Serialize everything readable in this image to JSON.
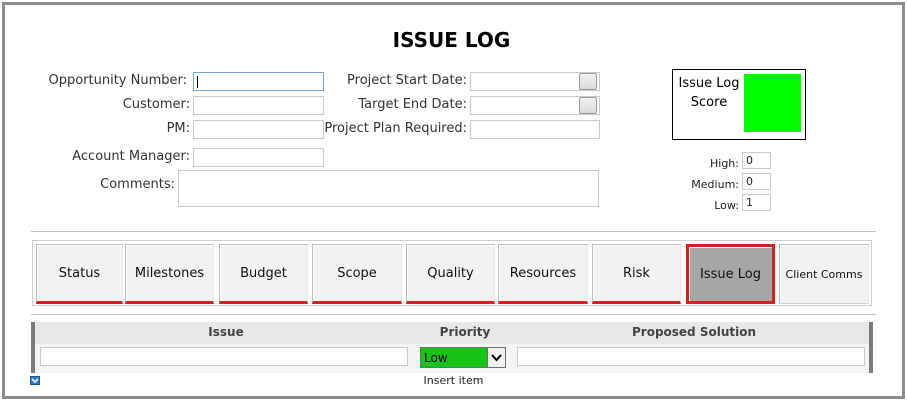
{
  "form": {
    "title": "ISSUE LOG",
    "fields": {
      "opportunity_number": {
        "label": "Opportunity Number:",
        "value": ""
      },
      "customer": {
        "label": "Customer:",
        "value": ""
      },
      "pm": {
        "label": "PM:",
        "value": ""
      },
      "account_manager": {
        "label": "Account Manager:",
        "value": ""
      },
      "comments": {
        "label": "Comments:",
        "value": ""
      },
      "project_start_date": {
        "label": "Project Start Date:",
        "value": ""
      },
      "target_end_date": {
        "label": "Target End Date:",
        "value": ""
      },
      "project_plan_required": {
        "label": "Project Plan Required:",
        "value": ""
      }
    }
  },
  "score": {
    "label": "Issue Log Score",
    "color": "#00ff00",
    "high_label": "High:",
    "high_value": "0",
    "medium_label": "Medium:",
    "medium_value": "0",
    "low_label": "Low:",
    "low_value": "1"
  },
  "tabs": [
    {
      "label": "Status"
    },
    {
      "label": "Milestones"
    },
    {
      "label": "Budget"
    },
    {
      "label": "Scope"
    },
    {
      "label": "Quality"
    },
    {
      "label": "Resources"
    },
    {
      "label": "Risk"
    },
    {
      "label": "Issue Log",
      "active": true
    },
    {
      "label": "Client Comms"
    }
  ],
  "grid": {
    "columns": {
      "issue": "Issue",
      "priority": "Priority",
      "solution": "Proposed Solution"
    },
    "row": {
      "issue": "",
      "priority": "Low",
      "solution": ""
    },
    "priority_color": "#16c416",
    "insert_label": "Insert item"
  },
  "colors": {
    "tab_underline": "#d42020",
    "active_tab_bg": "#a6a6a6"
  },
  "icons": {
    "calendar_button": "calendar-icon",
    "insert": "insert-item-icon",
    "dropdown": "chevron-down-icon"
  }
}
